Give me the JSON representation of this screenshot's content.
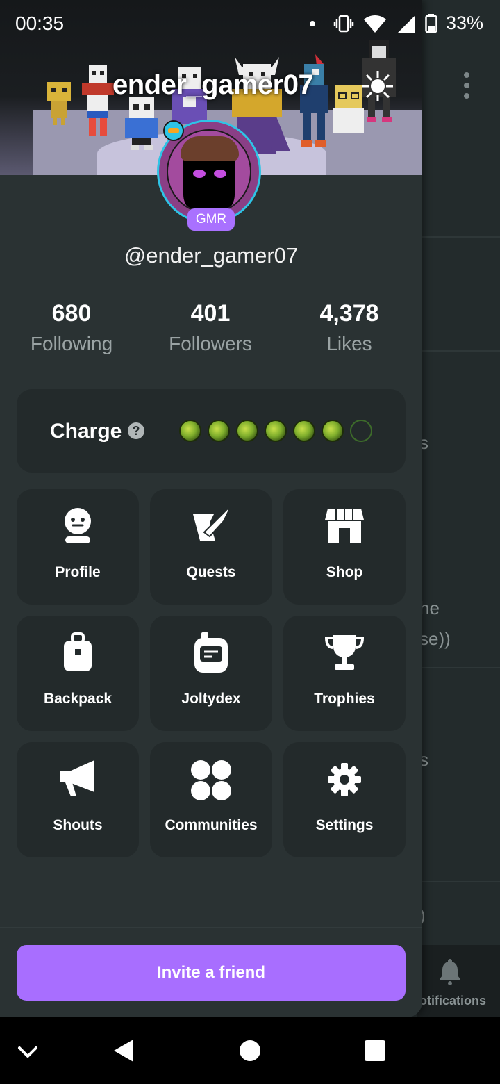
{
  "status_bar": {
    "time": "00:35",
    "battery": "33%"
  },
  "background_app": {
    "fragments": [
      "s",
      "he",
      "se))",
      "s",
      ")"
    ],
    "notifications_label": "otifications"
  },
  "profile": {
    "banner_name": "ender_gamer07",
    "handle": "@ender_gamer07",
    "badge": "GMR",
    "stats": [
      {
        "value": "680",
        "label": "Following"
      },
      {
        "value": "401",
        "label": "Followers"
      },
      {
        "value": "4,378",
        "label": "Likes"
      }
    ]
  },
  "charge": {
    "label": "Charge",
    "help": "?",
    "filled": 6,
    "total": 7
  },
  "menu": [
    {
      "label": "Profile",
      "icon": "profile-icon"
    },
    {
      "label": "Quests",
      "icon": "quests-icon"
    },
    {
      "label": "Shop",
      "icon": "shop-icon"
    },
    {
      "label": "Backpack",
      "icon": "backpack-icon"
    },
    {
      "label": "Joltydex",
      "icon": "joltydex-icon"
    },
    {
      "label": "Trophies",
      "icon": "trophy-icon"
    },
    {
      "label": "Shouts",
      "icon": "megaphone-icon"
    },
    {
      "label": "Communities",
      "icon": "communities-icon"
    },
    {
      "label": "Settings",
      "icon": "gear-icon"
    }
  ],
  "invite_button": "Invite a friend",
  "colors": {
    "accent": "#a86eff",
    "drawer_bg": "#2a3233",
    "tile_bg": "#232a2b",
    "ring": "#2ec4e6"
  }
}
